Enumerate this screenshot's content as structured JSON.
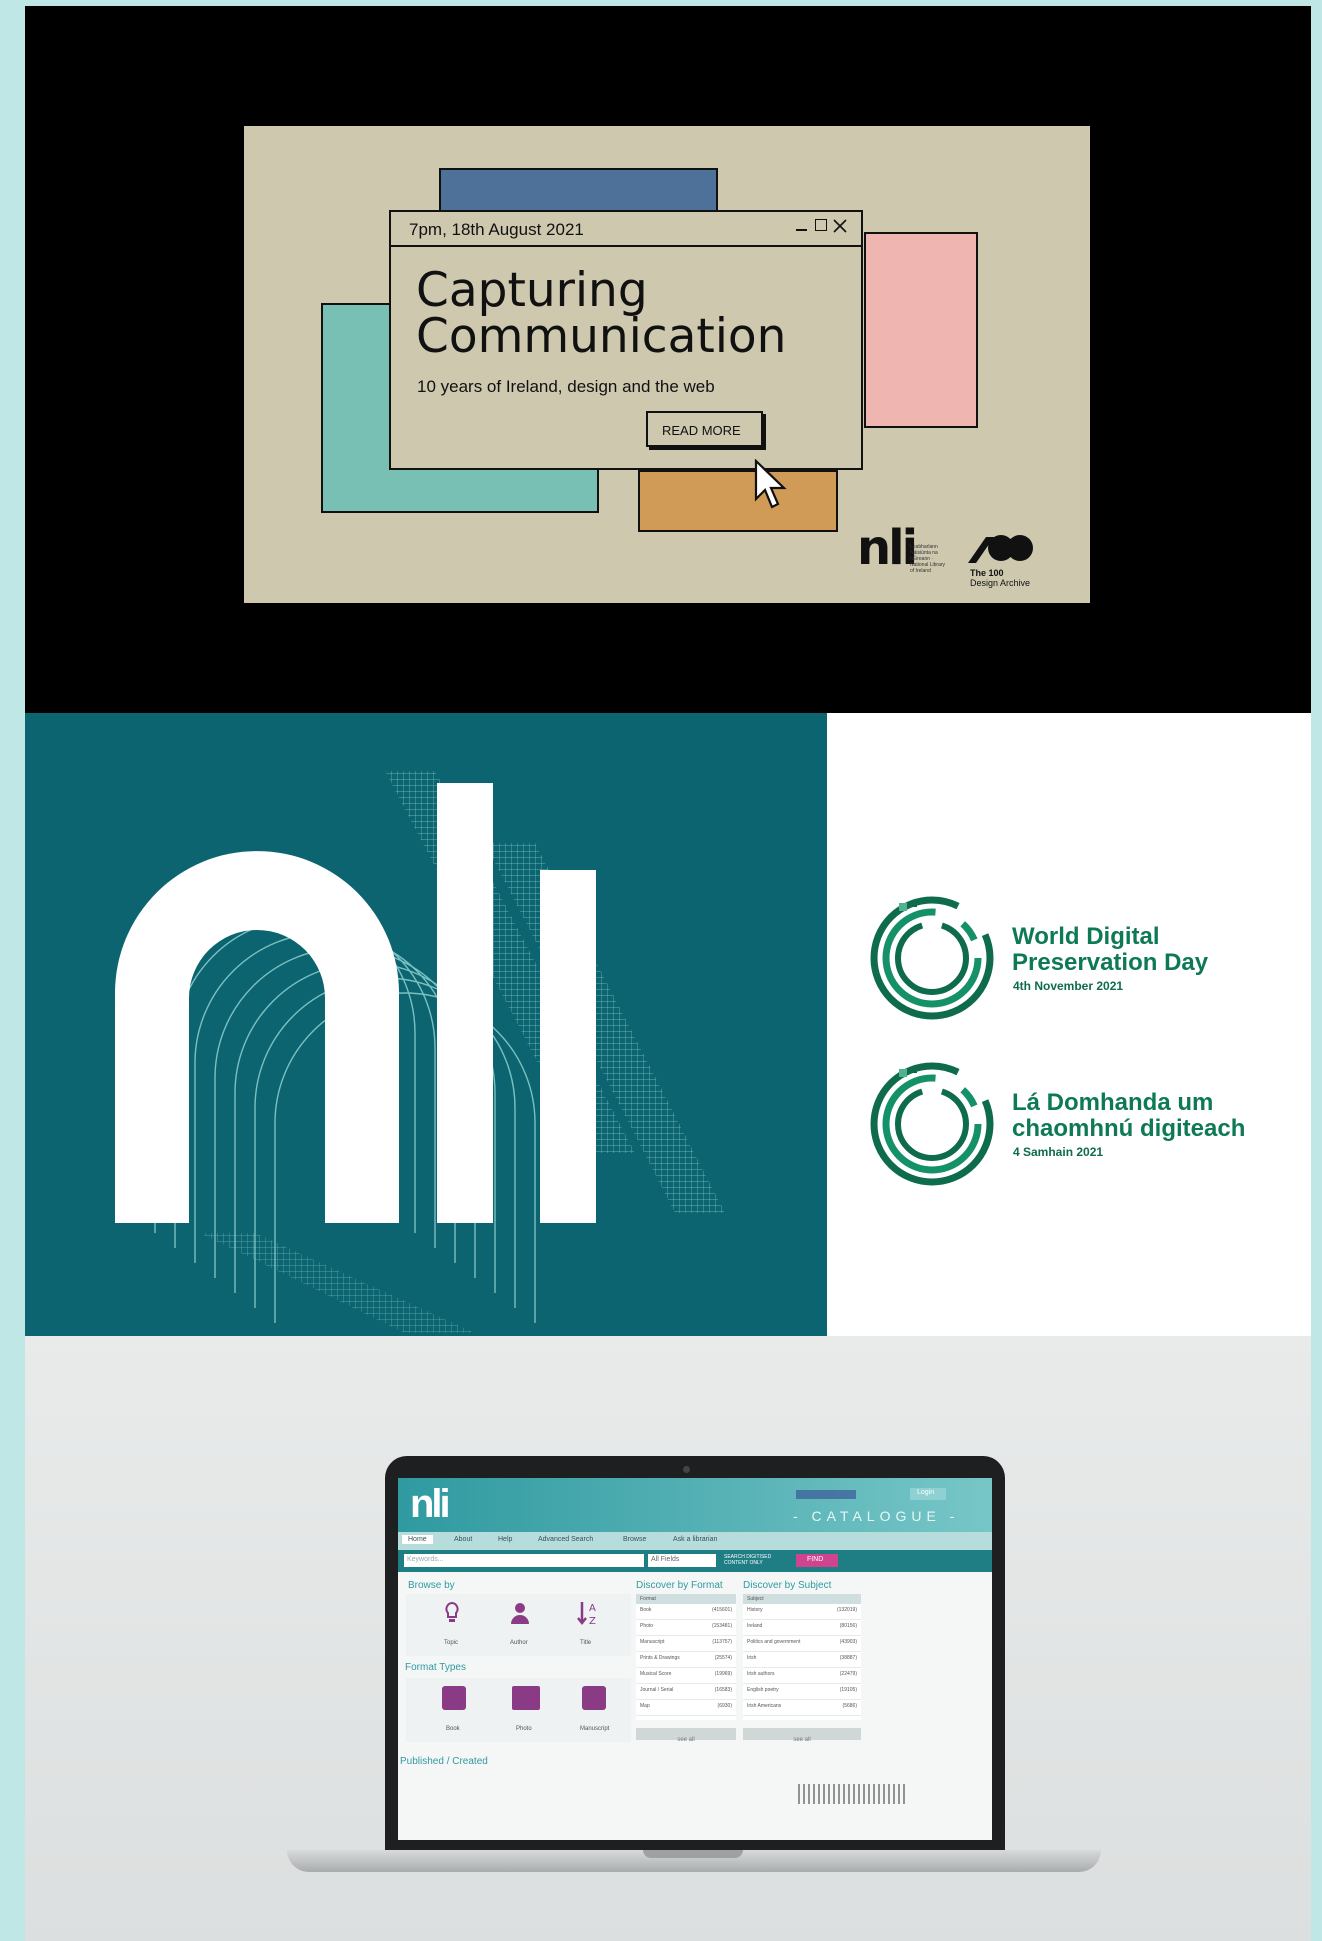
{
  "event_card": {
    "date_label": "7pm, 18th August 2021",
    "title_line1": "Capturing",
    "title_line2": "Communication",
    "subtitle": "10 years of Ireland, design and the web",
    "read_more": "READ MORE",
    "logo_nli": "nli",
    "nli_small": "Leabharlann Náisiúnta na hÉireann · National Library of Ireland",
    "logo_the100_line1": "The 100",
    "logo_the100_line2": "Design Archive",
    "window_controls": [
      "minimize-icon",
      "maximize-icon",
      "close-icon"
    ],
    "colors": {
      "beige": "#cdc8ae",
      "blue": "#4e7199",
      "teal": "#77c0b3",
      "pink": "#efb5b0",
      "orange": "#cf9b57"
    }
  },
  "identity": {
    "logo_letters": "nli",
    "bg_color": "#0b6470",
    "events": [
      {
        "title_line1": "World Digital",
        "title_line2": "Preservation Day",
        "date": "4th November 2021"
      },
      {
        "title_line1": "Lá Domhanda um",
        "title_line2": "chaomhnú digiteach",
        "date": "4 Samhain 2021"
      }
    ],
    "accent_green": "#0e7a55"
  },
  "laptop": {
    "header_word": "- CATALOGUE -",
    "login": "Login",
    "nav": [
      "Home",
      "About",
      "Help",
      "Advanced Search",
      "Browse",
      "Ask a librarian"
    ],
    "search_placeholder": "Keywords...",
    "field_select": "All Fields",
    "digitised_label": "SEARCH DIGITISED CONTENT ONLY",
    "find": "FIND",
    "browse_by": "Browse by",
    "browse_items": [
      "Topic",
      "Author",
      "Title"
    ],
    "format_types": "Format Types",
    "format_items": [
      "Book",
      "Photo",
      "Manuscript"
    ],
    "published": "Published / Created",
    "discover_format": "Discover by Format",
    "discover_subject": "Discover by Subject",
    "format_header": "Format",
    "subject_header": "Subject",
    "formats": [
      [
        "Book",
        "(415601)"
      ],
      [
        "Photo",
        "(153481)"
      ],
      [
        "Manuscript",
        "(113757)"
      ],
      [
        "Prints & Drawings",
        "(25574)"
      ],
      [
        "Musical Score",
        "(19969)"
      ],
      [
        "Journal / Serial",
        "(16583)"
      ],
      [
        "Map",
        "(6930)"
      ]
    ],
    "subjects": [
      [
        "History",
        "(132019)"
      ],
      [
        "Ireland",
        "(80156)"
      ],
      [
        "Politics and government",
        "(43903)"
      ],
      [
        "Irish",
        "(38887)"
      ],
      [
        "Irish authors",
        "(22479)"
      ],
      [
        "English poetry",
        "(19105)"
      ],
      [
        "Irish Americans",
        "(5686)"
      ]
    ],
    "see_all": "see all"
  }
}
